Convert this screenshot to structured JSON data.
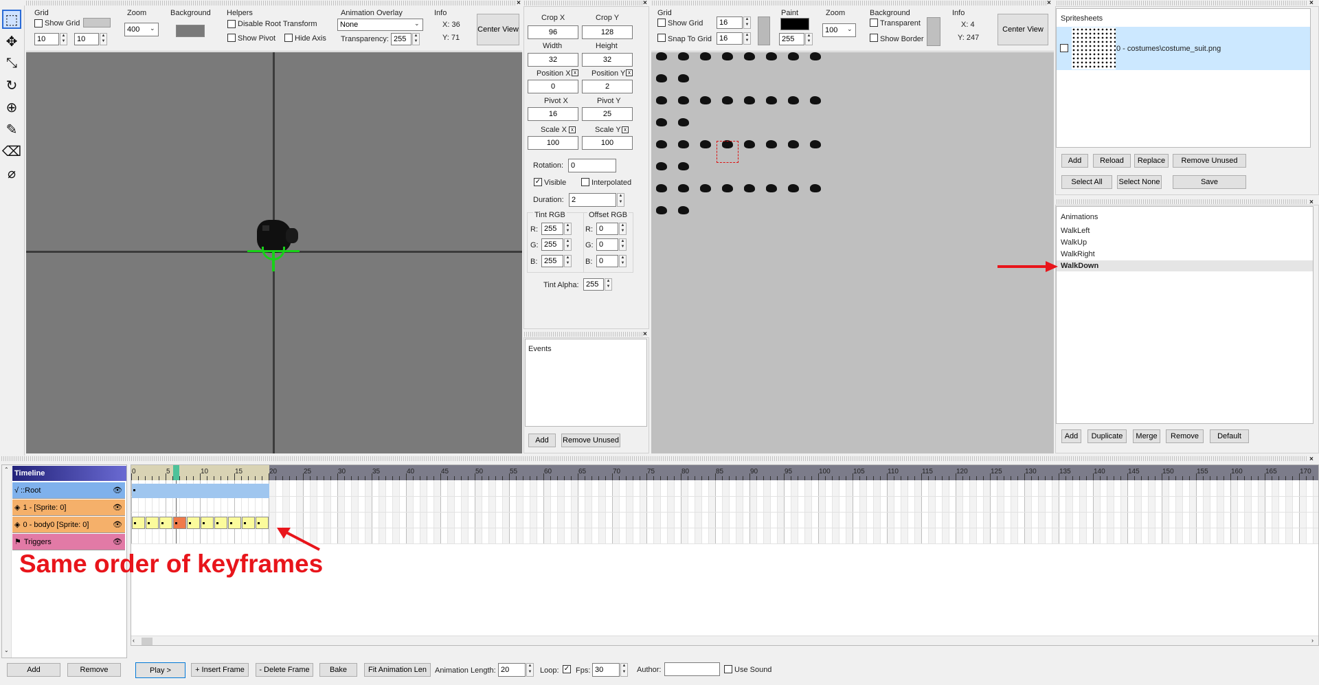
{
  "toolbar_top": {
    "grid": {
      "label": "Grid",
      "show_grid": "Show Grid",
      "x": "10",
      "y": "10"
    },
    "zoom": {
      "label": "Zoom",
      "value": "400"
    },
    "background": {
      "label": "Background"
    },
    "helpers": {
      "label": "Helpers",
      "disable_root": "Disable Root Transform",
      "show_pivot": "Show Pivot",
      "hide_axis": "Hide Axis"
    },
    "overlay": {
      "label": "Animation Overlay",
      "value": "None",
      "transparency_label": "Transparency:",
      "transparency": "255"
    },
    "info": {
      "label": "Info",
      "x": "X: 36",
      "y": "Y: 71"
    },
    "center_view": "Center View"
  },
  "props": {
    "crop_x_label": "Crop X",
    "crop_x": "96",
    "crop_y_label": "Crop Y",
    "crop_y": "128",
    "width_label": "Width",
    "width": "32",
    "height_label": "Height",
    "height": "32",
    "pos_x_label": "Position X",
    "pos_x": "0",
    "pos_y_label": "Position Y",
    "pos_y": "2",
    "pivot_x_label": "Pivot X",
    "pivot_x": "16",
    "pivot_y_label": "Pivot Y",
    "pivot_y": "25",
    "scale_x_label": "Scale X",
    "scale_x": "100",
    "scale_y_label": "Scale Y",
    "scale_y": "100",
    "rotation_label": "Rotation:",
    "rotation": "0",
    "visible": "Visible",
    "interpolated": "Interpolated",
    "duration_label": "Duration:",
    "duration": "2",
    "tint_label": "Tint RGB",
    "offset_label": "Offset RGB",
    "r": "R:",
    "g": "G:",
    "b": "B:",
    "tint_r": "255",
    "tint_g": "255",
    "tint_b": "255",
    "off_r": "0",
    "off_g": "0",
    "off_b": "0",
    "alpha_label": "Tint Alpha:",
    "alpha": "255"
  },
  "events": {
    "title": "Events",
    "add": "Add",
    "remove_unused": "Remove Unused"
  },
  "sheet_toolbar": {
    "grid_label": "Grid",
    "show_grid": "Show Grid",
    "snap": "Snap To Grid",
    "gx": "16",
    "gy": "16",
    "paint_label": "Paint",
    "paint_value": "255",
    "zoom_label": "Zoom",
    "zoom": "100",
    "bg_label": "Background",
    "transparent": "Transparent",
    "show_border": "Show Border",
    "info_label": "Info",
    "x": "X: 4",
    "y": "Y: 247",
    "center_view": "Center View"
  },
  "spritesheets": {
    "title": "Spritesheets",
    "item": "0 - costumes\\costume_suit.png",
    "add": "Add",
    "reload": "Reload",
    "replace": "Replace",
    "remove_unused": "Remove Unused",
    "select_all": "Select All",
    "select_none": "Select None",
    "save": "Save"
  },
  "animations": {
    "title": "Animations",
    "items": [
      "WalkLeft",
      "WalkUp",
      "WalkRight",
      "WalkDown"
    ],
    "selected": "WalkDown",
    "add": "Add",
    "duplicate": "Duplicate",
    "merge": "Merge",
    "remove": "Remove",
    "default": "Default"
  },
  "timeline": {
    "title": "Timeline",
    "layers": [
      {
        "name": "::Root",
        "color": "#7fb1ec"
      },
      {
        "name": "1 -  [Sprite: 0]",
        "color": "#f5b06a"
      },
      {
        "name": "0 - body0 [Sprite: 0]",
        "color": "#f5b06a"
      },
      {
        "name": "Triggers",
        "color": "#e27aa6"
      }
    ],
    "ticks": [
      "0",
      "5",
      "10",
      "15",
      "20",
      "25",
      "30",
      "35",
      "40",
      "45",
      "50",
      "55",
      "60",
      "65",
      "70",
      "75",
      "80",
      "85",
      "90",
      "95",
      "100",
      "105",
      "110",
      "115",
      "120",
      "125",
      "130",
      "135",
      "140",
      "145",
      "150",
      "155",
      "160",
      "165",
      "170"
    ],
    "add": "Add",
    "remove": "Remove"
  },
  "bottom_bar": {
    "play": "Play >",
    "insert": "+ Insert Frame",
    "delete": "- Delete Frame",
    "bake": "Bake",
    "fit": "Fit Animation Len",
    "length_label": "Animation Length:",
    "length": "20",
    "loop_label": "Loop:",
    "fps_label": "Fps:",
    "fps": "30",
    "author_label": "Author:",
    "author": "",
    "sound": "Use Sound"
  },
  "annotation": "Same order of keyframes",
  "colors": {
    "accent_red": "#e8151b",
    "selection": "#cce8ff",
    "canvas": "#7a7a7a",
    "sheet_bg": "#bfbfbf"
  }
}
